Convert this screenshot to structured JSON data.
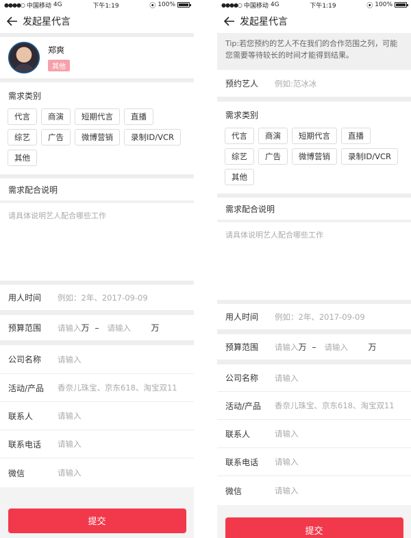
{
  "status_bar": {
    "signal": "●●●●○",
    "carrier": "中国移动",
    "network": "4G",
    "time": "下午1:19",
    "battery": "100%"
  },
  "nav": {
    "title": "发起星代言"
  },
  "left": {
    "artist": {
      "name": "郑爽",
      "tag": "其他"
    },
    "demand_title": "需求类别",
    "tags": [
      "代言",
      "商演",
      "短期代言",
      "直播",
      "综艺",
      "广告",
      "微博营销",
      "录制ID/VCR",
      "其他"
    ],
    "cooperation_title": "需求配合说明",
    "cooperation_placeholder": "请具体说明艺人配合哪些工作",
    "form": {
      "time_label": "用人时间",
      "time_placeholder": "例如：2年、2017-09-09",
      "budget_label": "预算范围",
      "budget_placeholder": "请输入",
      "budget_unit": "万",
      "budget_dash": "–",
      "company_label": "公司名称",
      "company_placeholder": "请输入",
      "activity_label": "活动/产品",
      "activity_placeholder": "香奈儿珠宝、京东618、淘宝双11",
      "contact_label": "联系人",
      "contact_placeholder": "请输入",
      "phone_label": "联系电话",
      "phone_placeholder": "请输入",
      "wechat_label": "微信",
      "wechat_placeholder": "请输入"
    },
    "submit": "提交"
  },
  "right": {
    "tip": "Tip:若您预约的艺人不在我们的合作范围之列，可能您需要等待较长的时间才能得到结果。",
    "artist_label": "预约艺人",
    "artist_placeholder": "例如:范冰冰",
    "demand_title": "需求类别",
    "tags": [
      "代言",
      "商演",
      "短期代言",
      "直播",
      "综艺",
      "广告",
      "微博营销",
      "录制ID/VCR",
      "其他"
    ],
    "cooperation_title": "需求配合说明",
    "cooperation_placeholder": "请具体说明艺人配合哪些工作",
    "form": {
      "time_label": "用人时间",
      "time_placeholder": "例如：2年、2017-09-09",
      "budget_label": "预算范围",
      "budget_placeholder": "请输入",
      "budget_unit": "万",
      "budget_dash": "–",
      "company_label": "公司名称",
      "company_placeholder": "请输入",
      "activity_label": "活动/产品",
      "activity_placeholder": "香奈儿珠宝、京东618、淘宝双11",
      "contact_label": "联系人",
      "contact_placeholder": "请输入",
      "phone_label": "联系电话",
      "phone_placeholder": "请输入",
      "wechat_label": "微信",
      "wechat_placeholder": "请输入"
    },
    "submit": "提交"
  }
}
